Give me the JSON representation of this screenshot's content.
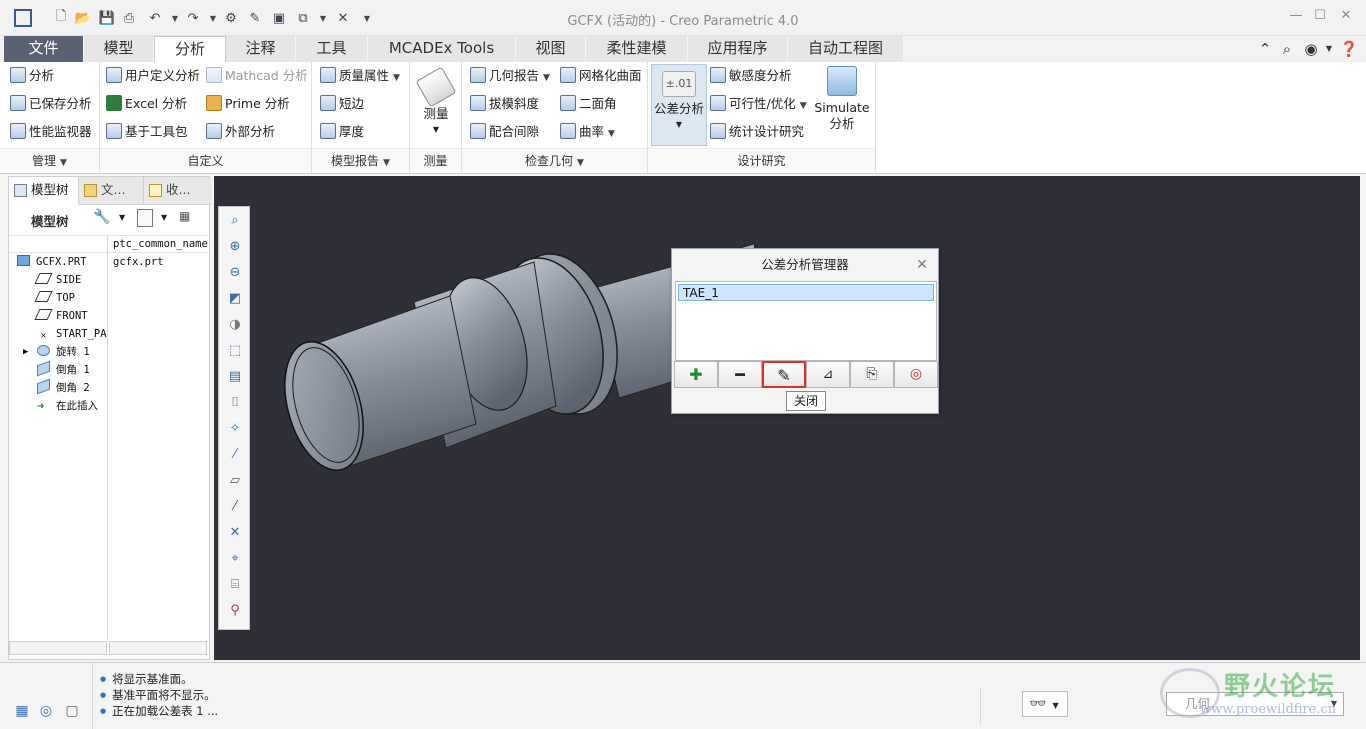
{
  "window": {
    "title": "GCFX (活动的) - Creo Parametric 4.0"
  },
  "menu": {
    "tabs": [
      "文件",
      "模型",
      "分析",
      "注释",
      "工具",
      "MCADEx Tools",
      "视图",
      "柔性建模",
      "应用程序",
      "自动工程图"
    ],
    "active": "分析"
  },
  "ribbon": {
    "manage": {
      "title": "管理",
      "items": [
        "分析",
        "已保存分析",
        "性能监视器"
      ]
    },
    "custom": {
      "title": "自定义",
      "items": [
        "用户定义分析",
        "Mathcad 分析",
        "Excel 分析",
        "Prime 分析",
        "基于工具包",
        "外部分析"
      ]
    },
    "model_report": {
      "title": "模型报告",
      "items": [
        "质量属性",
        "短边",
        "厚度"
      ]
    },
    "measure": {
      "title": "测量",
      "label": "测量"
    },
    "inspect": {
      "title": "检查几何",
      "items": [
        "几何报告",
        "网格化曲面",
        "拔模斜度",
        "二面角",
        "配合间隙",
        "曲率"
      ]
    },
    "design_study": {
      "title": "设计研究",
      "tol": "公差分析",
      "items": [
        "敏感度分析",
        "可行性/优化",
        "统计设计研究"
      ],
      "simulate": "Simulate",
      "simulate2": "分析"
    }
  },
  "left_panel": {
    "tabs": [
      "模型树",
      "文...",
      "收..."
    ],
    "header": "模型树",
    "column": "ptc_common_name",
    "root": {
      "name": "GCFX.PRT",
      "value": "gcfx.prt"
    },
    "nodes": [
      "SIDE",
      "TOP",
      "FRONT",
      "START_PA",
      "旋转 1",
      "倒角 1",
      "倒角 2",
      "在此插入"
    ]
  },
  "dialog": {
    "title": "公差分析管理器",
    "items": [
      "TAE_1"
    ],
    "tooltip": "关闭"
  },
  "status": {
    "messages": [
      "将显示基准面。",
      "基准平面将不显示。",
      "正在加载公差表 1 ..."
    ],
    "filter": "几何"
  },
  "watermark": {
    "text": "野火论坛",
    "url": "www.proewildfire.cn"
  },
  "colors": {
    "viewport": "#2f3037",
    "file_tab": "#5a6172",
    "highlight": "#d9342b"
  }
}
